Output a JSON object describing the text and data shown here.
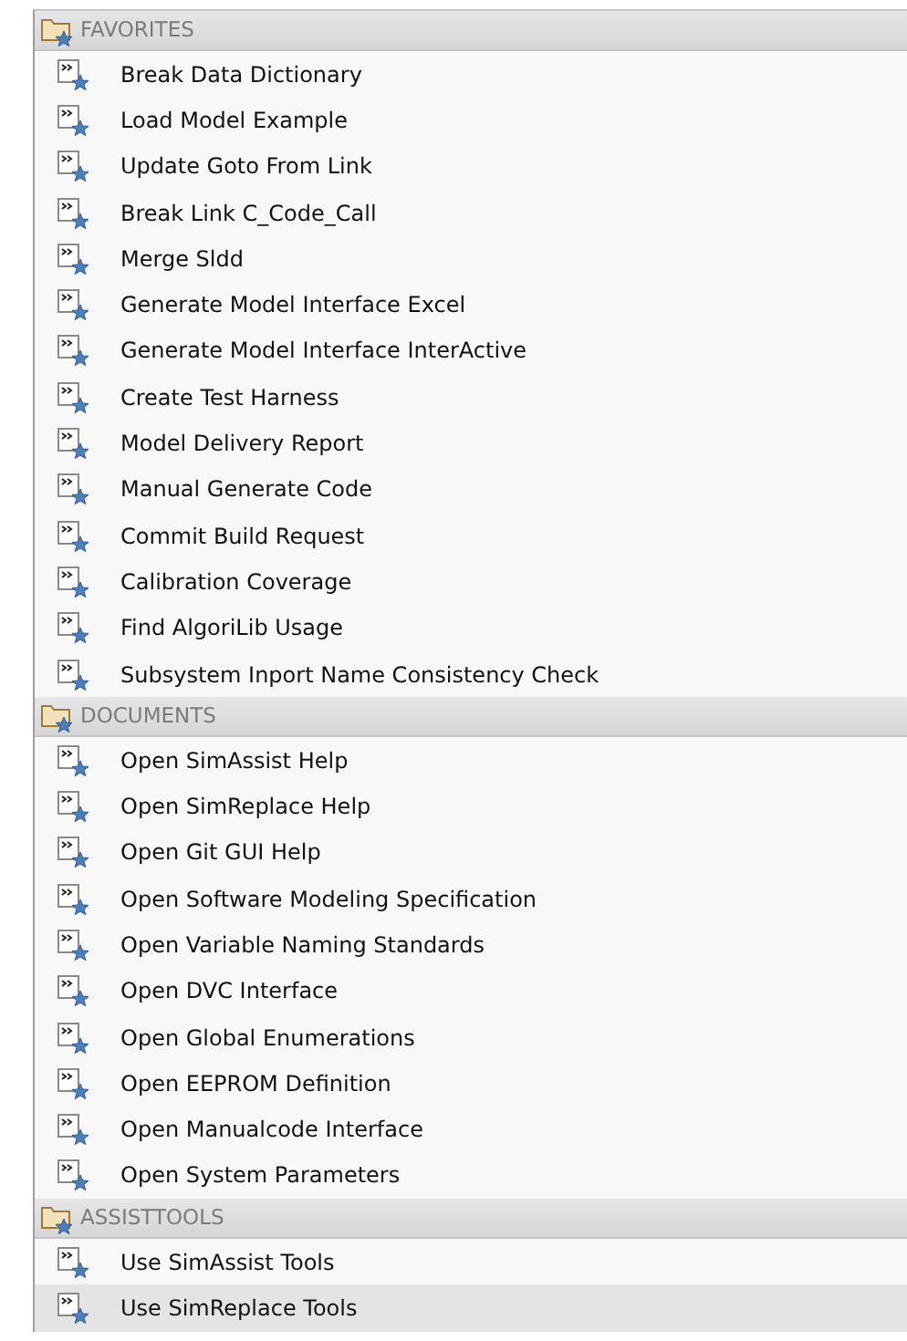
{
  "sections": [
    {
      "title": "FAVORITES",
      "items": [
        {
          "label": "Break Data Dictionary",
          "selected": false
        },
        {
          "label": "Load Model Example",
          "selected": false
        },
        {
          "label": "Update Goto From Link",
          "selected": false
        },
        {
          "label": "Break Link C_Code_Call",
          "selected": false
        },
        {
          "label": "Merge Sldd",
          "selected": false
        },
        {
          "label": "Generate Model Interface Excel",
          "selected": false
        },
        {
          "label": "Generate Model Interface InterActive",
          "selected": false
        },
        {
          "label": "Create Test Harness",
          "selected": false
        },
        {
          "label": "Model Delivery Report",
          "selected": false
        },
        {
          "label": "Manual Generate Code",
          "selected": false
        },
        {
          "label": "Commit Build Request",
          "selected": false
        },
        {
          "label": "Calibration Coverage",
          "selected": false
        },
        {
          "label": "Find AlgoriLib Usage",
          "selected": false
        },
        {
          "label": "Subsystem Inport Name Consistency Check",
          "selected": false
        }
      ]
    },
    {
      "title": "DOCUMENTS",
      "items": [
        {
          "label": "Open SimAssist Help",
          "selected": false
        },
        {
          "label": "Open SimReplace Help",
          "selected": false
        },
        {
          "label": "Open Git GUI Help",
          "selected": false
        },
        {
          "label": "Open Software Modeling Specification",
          "selected": false
        },
        {
          "label": "Open Variable Naming Standards",
          "selected": false
        },
        {
          "label": "Open DVC Interface",
          "selected": false
        },
        {
          "label": "Open Global Enumerations",
          "selected": false
        },
        {
          "label": "Open EEPROM Definition",
          "selected": false
        },
        {
          "label": "Open Manualcode Interface",
          "selected": false
        },
        {
          "label": "Open System Parameters",
          "selected": false
        }
      ]
    },
    {
      "title": "ASSISTTOOLS",
      "items": [
        {
          "label": "Use SimAssist Tools",
          "selected": false
        },
        {
          "label": "Use SimReplace Tools",
          "selected": true
        }
      ]
    }
  ]
}
